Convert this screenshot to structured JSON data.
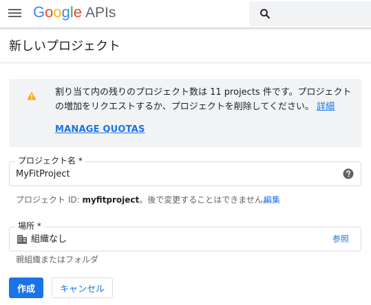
{
  "header": {
    "brand_letters": [
      "G",
      "o",
      "o",
      "g",
      "l",
      "e"
    ],
    "brand_suffix": "APIs",
    "menu_icon": "hamburger-menu-icon",
    "search_icon": "search-icon"
  },
  "page": {
    "title": "新しいプロジェクト"
  },
  "notice": {
    "icon": "warning-icon",
    "text": "割り当て内の残りのプロジェクト数は 11 projects 件です。プロジェクトの増加をリクエストするか、プロジェクトを削除してください。",
    "details_link": "詳細",
    "manage_quotas": "MANAGE QUOTAS"
  },
  "project_name": {
    "label": "プロジェクト名 *",
    "value": "MyFitProject",
    "help_icon": "help-circle-icon"
  },
  "project_id": {
    "prefix": "プロジェクト ID: ",
    "id": "myfitproject",
    "suffix": "。後で変更することはできません。",
    "edit_link": "編集"
  },
  "location": {
    "label": "場所 *",
    "value": "組織なし",
    "icon": "building-icon",
    "browse_link": "参照",
    "hint": "親組織またはフォルダ"
  },
  "actions": {
    "create_label": "作成",
    "cancel_label": "キャンセル"
  },
  "colors": {
    "accent": "#1a73e8",
    "warning": "#f9ab00",
    "notice_bg": "#f1f3f4"
  }
}
